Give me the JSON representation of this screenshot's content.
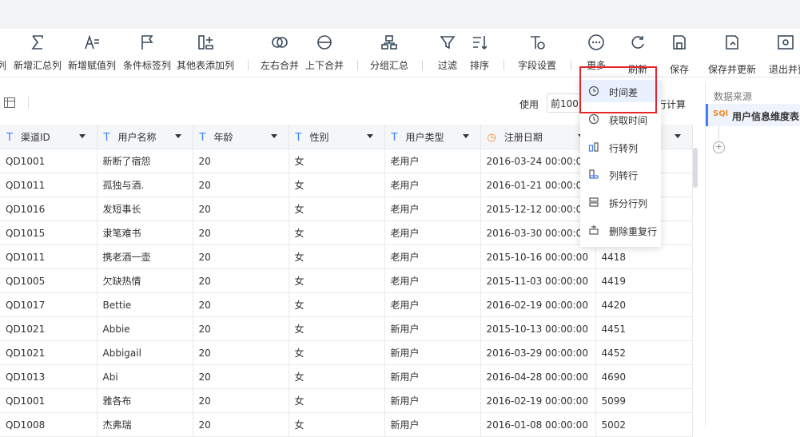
{
  "toolbar": {
    "items": [
      {
        "label": "列",
        "icon": "partial-icon"
      },
      {
        "label": "新增汇总列",
        "icon": "sigma-icon"
      },
      {
        "label": "新增赋值列",
        "icon": "assign-column-icon"
      },
      {
        "label": "条件标签列",
        "icon": "flag-icon"
      },
      {
        "label": "其他表添加列",
        "icon": "add-column-icon"
      },
      {
        "label": "左右合并",
        "icon": "merge-horizontal-icon"
      },
      {
        "label": "上下合并",
        "icon": "merge-vertical-icon"
      },
      {
        "label": "分组汇总",
        "icon": "group-summary-icon"
      },
      {
        "label": "过滤",
        "icon": "filter-icon"
      },
      {
        "label": "排序",
        "icon": "sort-icon"
      },
      {
        "label": "字段设置",
        "icon": "field-settings-icon"
      },
      {
        "label": "更多",
        "icon": "more-icon"
      },
      {
        "label": "刷新",
        "icon": "refresh-icon"
      },
      {
        "label": "保存",
        "icon": "save-icon"
      },
      {
        "label": "保存并更新",
        "icon": "save-update-icon"
      },
      {
        "label": "退出并预",
        "icon": "exit-preview-icon"
      }
    ]
  },
  "subbar": {
    "use_label": "使用",
    "use_select": "前100",
    "exec_label": "行计算"
  },
  "table": {
    "columns": [
      {
        "label": "渠道ID",
        "type": "T"
      },
      {
        "label": "用户名称",
        "type": "T"
      },
      {
        "label": "年龄",
        "type": "T"
      },
      {
        "label": "性别",
        "type": "T"
      },
      {
        "label": "用户类型",
        "type": "T"
      },
      {
        "label": "注册日期",
        "type": "date"
      },
      {
        "label": "",
        "type": ""
      }
    ],
    "rows": [
      [
        "QD1001",
        "新断了宿怨",
        "20",
        "女",
        "老用户",
        "2016-03-24 00:00:00",
        ""
      ],
      [
        "QD1011",
        "孤独与酒.",
        "20",
        "女",
        "老用户",
        "2016-01-21 00:00:00",
        ""
      ],
      [
        "QD1016",
        "发短事长",
        "20",
        "女",
        "老用户",
        "2015-12-12 00:00:00",
        ""
      ],
      [
        "QD1015",
        "隶笔难书",
        "20",
        "女",
        "老用户",
        "2016-03-30 00:00:00",
        ""
      ],
      [
        "QD1011",
        "携老酒一壶",
        "20",
        "女",
        "老用户",
        "2015-10-16 00:00:00",
        "4418"
      ],
      [
        "QD1005",
        "欠缺热情",
        "20",
        "女",
        "老用户",
        "2015-11-03 00:00:00",
        "4419"
      ],
      [
        "QD1017",
        "Bettie",
        "20",
        "女",
        "老用户",
        "2016-02-19 00:00:00",
        "4420"
      ],
      [
        "QD1021",
        "Abbie",
        "20",
        "女",
        "新用户",
        "2015-10-13 00:00:00",
        "4451"
      ],
      [
        "QD1021",
        "Abbigail",
        "20",
        "女",
        "新用户",
        "2016-03-29 00:00:00",
        "4452"
      ],
      [
        "QD1013",
        "Abi",
        "20",
        "女",
        "新用户",
        "2016-04-28 00:00:00",
        "4690"
      ],
      [
        "QD1001",
        "雅各布",
        "20",
        "女",
        "新用户",
        "2016-02-19 00:00:00",
        "5099"
      ],
      [
        "QD1008",
        "杰弗瑞",
        "20",
        "女",
        "新用户",
        "2016-01-08 00:00:00",
        "5002"
      ]
    ]
  },
  "right_panel": {
    "title": "数据来源",
    "sql_badge": "SQl",
    "item": "用户信息维度表"
  },
  "dropdown": {
    "items": [
      {
        "label": "时间差",
        "icon": "clock-icon",
        "active": true
      },
      {
        "label": "获取时间",
        "icon": "get-time-icon",
        "active": false
      },
      {
        "label": "行转列",
        "icon": "row-to-col-icon",
        "active": false
      },
      {
        "label": "列转行",
        "icon": "col-to-row-icon",
        "active": false
      },
      {
        "label": "拆分行列",
        "icon": "split-icon",
        "active": false
      },
      {
        "label": "删除重复行",
        "icon": "dedupe-icon",
        "active": false
      }
    ]
  },
  "colors": {
    "accent": "#3d7eff",
    "date_type": "#f08c2e",
    "highlight_box": "#e5262a"
  }
}
